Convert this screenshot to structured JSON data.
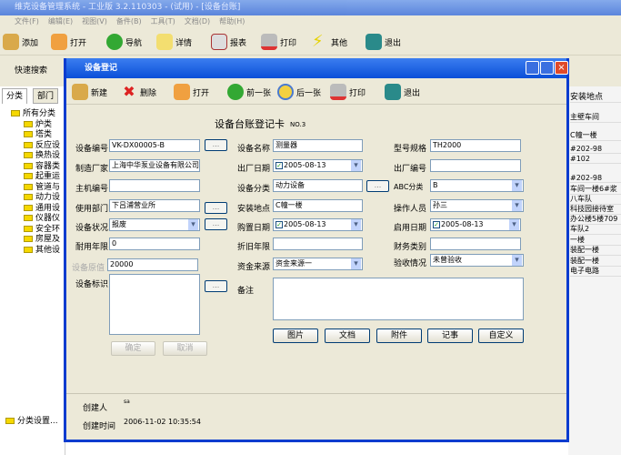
{
  "app": {
    "title": "维克设备管理系统 - 工业版 3.2.110303 - (试用) - [设备台账]",
    "menu": [
      "文件(F)",
      "编辑(E)",
      "视图(V)",
      "备件(B)",
      "工具(T)",
      "文档(D)",
      "帮助(H)"
    ],
    "toolbar": [
      {
        "label": "添加",
        "icon": "add-icon"
      },
      {
        "label": "打开",
        "icon": "open-icon"
      },
      {
        "label": "导航",
        "icon": "navigate-icon"
      },
      {
        "label": "详情",
        "icon": "folder-icon"
      },
      {
        "label": "报表",
        "icon": "report-icon"
      },
      {
        "label": "打印",
        "icon": "printer-icon"
      },
      {
        "label": "其他",
        "icon": "lightning-icon"
      },
      {
        "label": "退出",
        "icon": "exit-icon"
      }
    ],
    "quick_search": "快速搜索",
    "left_tabs": [
      "分类",
      "部门"
    ],
    "tree": [
      "所有分类",
      "炉类",
      "塔类",
      "反应设",
      "换热设",
      "容器类",
      "起重运",
      "管道与",
      "动力设",
      "通用设",
      "仪器仪",
      "安全环",
      "房屋及",
      "其他设"
    ],
    "category_settings": "分类设置...",
    "right_header": "安装地点",
    "right_items": [
      "主壁车间",
      "C幢一楼",
      "#202-98",
      "#102",
      "#202-98",
      "车间一楼6#浆",
      "八车队",
      "科技园接待室",
      "办公楼5楼709",
      "车队2",
      "一楼",
      "装配一楼",
      "装配一楼",
      "电子电路"
    ]
  },
  "dialog": {
    "title": "设备登记",
    "toolbar": [
      {
        "label": "新建",
        "icon": "new-icon"
      },
      {
        "label": "删除",
        "icon": "delete-icon"
      },
      {
        "label": "打开",
        "icon": "open-icon"
      },
      {
        "label": "前一张",
        "icon": "back-icon"
      },
      {
        "label": "后一张",
        "icon": "forward-icon"
      },
      {
        "label": "打印",
        "icon": "printer-icon"
      },
      {
        "label": "退出",
        "icon": "exit-icon"
      }
    ],
    "heading": "设备台账登记卡",
    "card_no": "NO.3",
    "fields": {
      "equip_no": {
        "label": "设备编号",
        "value": "VK-DX00005-B"
      },
      "maker": {
        "label": "制造厂家",
        "value": "上海中华泵业设备有限公司"
      },
      "host_no": {
        "label": "主机编号",
        "value": ""
      },
      "dept": {
        "label": "使用部门",
        "value": "下吕浦营业所"
      },
      "status": {
        "label": "设备状况",
        "value": "报废"
      },
      "life": {
        "label": "耐用年限",
        "value": "0"
      },
      "orig_value": {
        "label": "设备原值",
        "value": "20000"
      },
      "mark": {
        "label": "设备标识",
        "value": ""
      },
      "name": {
        "label": "设备名称",
        "value": "测量器"
      },
      "factory_date": {
        "label": "出厂日期",
        "value": "2005-08-13"
      },
      "category": {
        "label": "设备分类",
        "value": "动力设备"
      },
      "location": {
        "label": "安装地点",
        "value": "C幢一楼"
      },
      "purchase_date": {
        "label": "购置日期",
        "value": "2005-08-13"
      },
      "depr_years": {
        "label": "折旧年限",
        "value": ""
      },
      "fund": {
        "label": "资金来源",
        "value": "资金来源一"
      },
      "remark": {
        "label": "备注",
        "value": ""
      },
      "model": {
        "label": "型号规格",
        "value": "TH2000"
      },
      "factory_no": {
        "label": "出厂编号",
        "value": ""
      },
      "abc": {
        "label": "ABC分类",
        "value": "B"
      },
      "operator": {
        "label": "操作人员",
        "value": "孙三"
      },
      "start_date": {
        "label": "启用日期",
        "value": "2005-08-13"
      },
      "finance": {
        "label": "财务类别",
        "value": ""
      },
      "acceptance": {
        "label": "验收情况",
        "value": "未曾验收"
      }
    },
    "buttons": {
      "ok": "确定",
      "cancel": "取消",
      "picture": "图片",
      "document": "文档",
      "attachment": "附件",
      "notes": "记事",
      "custom": "自定义",
      "browse": "..."
    },
    "creator_label": "创建人",
    "creator": "sa",
    "created_label": "创建时间",
    "created": "2006-11-02 10:35:54"
  }
}
